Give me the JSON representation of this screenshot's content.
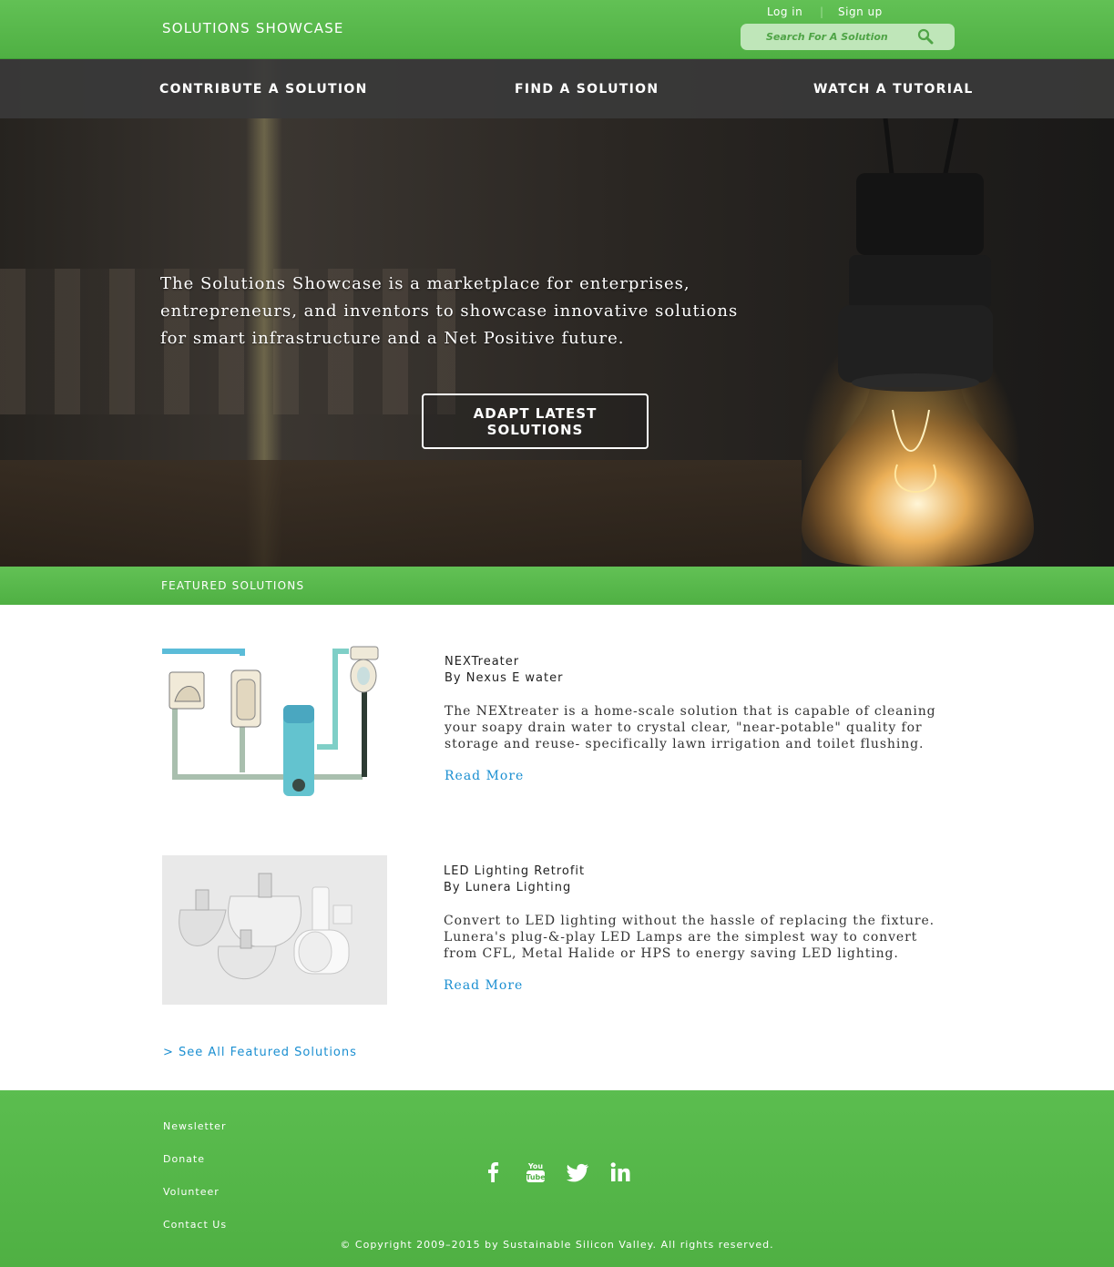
{
  "header": {
    "site_title": "SOLUTIONS SHOWCASE",
    "login": "Log in",
    "separator": "|",
    "signup": "Sign up",
    "search_placeholder": "Search For A Solution",
    "search_icon": "search-icon"
  },
  "nav": {
    "items": [
      {
        "label": "CONTRIBUTE A SOLUTION"
      },
      {
        "label": "FIND A SOLUTION"
      },
      {
        "label": "WATCH A TUTORIAL"
      }
    ]
  },
  "hero": {
    "text": "The Solutions Showcase is a marketplace for enterprises, entrepreneurs, and inventors to showcase innovative solutions for smart infrastructure and a Net Positive future.",
    "cta": "ADAPT LATEST SOLUTIONS"
  },
  "featured": {
    "title": "FEATURED SOLUTIONS",
    "solutions": [
      {
        "title": "NEXTreater",
        "by": "By Nexus E water",
        "description": "The NEXtreater is a home-scale solution that is capable of cleaning your soapy drain water to crystal clear, \"near-potable\" quality for storage and reuse- specifically lawn irrigation and toilet flushing.",
        "read_more": "Read More"
      },
      {
        "title": "LED Lighting Retrofit",
        "by": "By Lunera Lighting",
        "description": "Convert to LED lighting without the hassle of replacing the fixture. Lunera's plug-&-play LED Lamps are the simplest way to convert from CFL, Metal Halide or HPS to energy saving LED lighting.",
        "read_more": "Read More"
      }
    ],
    "see_all": "> See All Featured Solutions"
  },
  "footer": {
    "links": [
      {
        "label": "Newsletter"
      },
      {
        "label": "Donate"
      },
      {
        "label": "Volunteer"
      },
      {
        "label": "Contact Us"
      }
    ],
    "social": [
      "facebook-icon",
      "youtube-icon",
      "twitter-icon",
      "linkedin-icon"
    ],
    "copyright": "© Copyright 2009–2015 by Sustainable Silicon Valley. All rights reserved."
  },
  "colors": {
    "brand_green": "#55b449",
    "link_blue": "#1b8fd1",
    "nav_dark": "#3a3a3a"
  }
}
